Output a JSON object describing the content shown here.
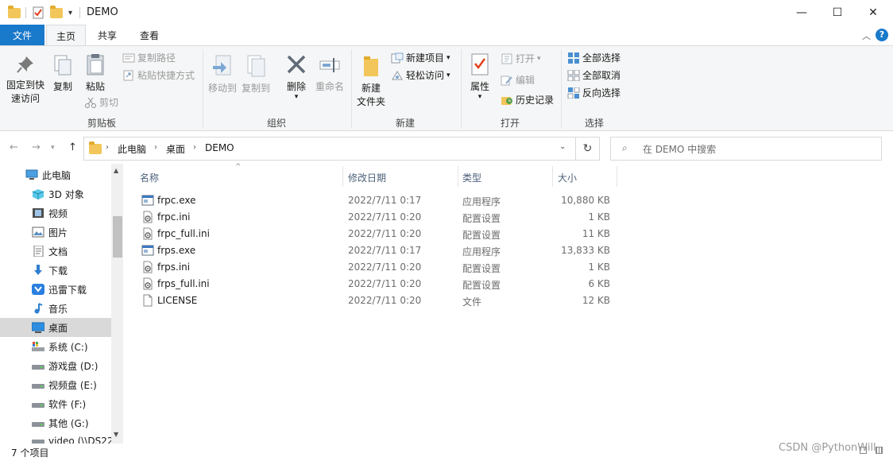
{
  "window": {
    "title": "DEMO",
    "minimize": "—",
    "maximize": "☐",
    "close": "✕"
  },
  "ribbon_tabs": [
    "文件",
    "主页",
    "共享",
    "查看"
  ],
  "ribbon": {
    "clipboard": {
      "pin_line1": "固定到快",
      "pin_line2": "速访问",
      "copy": "复制",
      "paste": "粘贴",
      "copy_path": "复制路径",
      "paste_shortcut": "粘贴快捷方式",
      "cut": "剪切",
      "label": "剪贴板"
    },
    "organize": {
      "move_to": "移动到",
      "copy_to": "复制到",
      "delete": "删除",
      "rename": "重命名",
      "label": "组织"
    },
    "new": {
      "new_folder_line1": "新建",
      "new_folder_line2": "文件夹",
      "new_item": "新建项目",
      "easy_access": "轻松访问",
      "label": "新建"
    },
    "open": {
      "properties": "属性",
      "open": "打开",
      "edit": "编辑",
      "history": "历史记录",
      "label": "打开"
    },
    "select": {
      "select_all": "全部选择",
      "select_none": "全部取消",
      "invert": "反向选择",
      "label": "选择"
    }
  },
  "address": {
    "crumbs": [
      "此电脑",
      "桌面",
      "DEMO"
    ],
    "search_placeholder": "在 DEMO 中搜索"
  },
  "nav_items": [
    {
      "label": "此电脑",
      "icon": "computer-icon"
    },
    {
      "label": "3D 对象",
      "icon": "3d-objects-icon"
    },
    {
      "label": "视频",
      "icon": "video-icon"
    },
    {
      "label": "图片",
      "icon": "pictures-icon"
    },
    {
      "label": "文档",
      "icon": "documents-icon"
    },
    {
      "label": "下载",
      "icon": "download-icon"
    },
    {
      "label": "迅雷下载",
      "icon": "thunder-icon"
    },
    {
      "label": "音乐",
      "icon": "music-icon"
    },
    {
      "label": "桌面",
      "icon": "desktop-icon"
    },
    {
      "label": "系统 (C:)",
      "icon": "system-drive-icon"
    },
    {
      "label": "游戏盘 (D:)",
      "icon": "drive-icon"
    },
    {
      "label": "视频盘 (E:)",
      "icon": "drive-icon"
    },
    {
      "label": "软件 (F:)",
      "icon": "drive-icon"
    },
    {
      "label": "其他 (G:)",
      "icon": "drive-icon"
    },
    {
      "label": "video (\\\\DS22",
      "icon": "network-drive-icon"
    }
  ],
  "columns": {
    "name": "名称",
    "date": "修改日期",
    "type": "类型",
    "size": "大小"
  },
  "files": [
    {
      "name": "frpc.exe",
      "date": "2022/7/11 0:17",
      "type": "应用程序",
      "size": "10,880 KB",
      "icon": "exe-icon"
    },
    {
      "name": "frpc.ini",
      "date": "2022/7/11 0:20",
      "type": "配置设置",
      "size": "1 KB",
      "icon": "ini-icon"
    },
    {
      "name": "frpc_full.ini",
      "date": "2022/7/11 0:20",
      "type": "配置设置",
      "size": "11 KB",
      "icon": "ini-icon"
    },
    {
      "name": "frps.exe",
      "date": "2022/7/11 0:17",
      "type": "应用程序",
      "size": "13,833 KB",
      "icon": "exe-icon"
    },
    {
      "name": "frps.ini",
      "date": "2022/7/11 0:20",
      "type": "配置设置",
      "size": "1 KB",
      "icon": "ini-icon"
    },
    {
      "name": "frps_full.ini",
      "date": "2022/7/11 0:20",
      "type": "配置设置",
      "size": "6 KB",
      "icon": "ini-icon"
    },
    {
      "name": "LICENSE",
      "date": "2022/7/11 0:20",
      "type": "文件",
      "size": "12 KB",
      "icon": "file-icon"
    }
  ],
  "status": {
    "count": "7 个项目"
  },
  "watermark": "CSDN @PythonWill",
  "colors": {
    "accent": "#1979ca",
    "selected_nav": "#d9d9d9"
  }
}
